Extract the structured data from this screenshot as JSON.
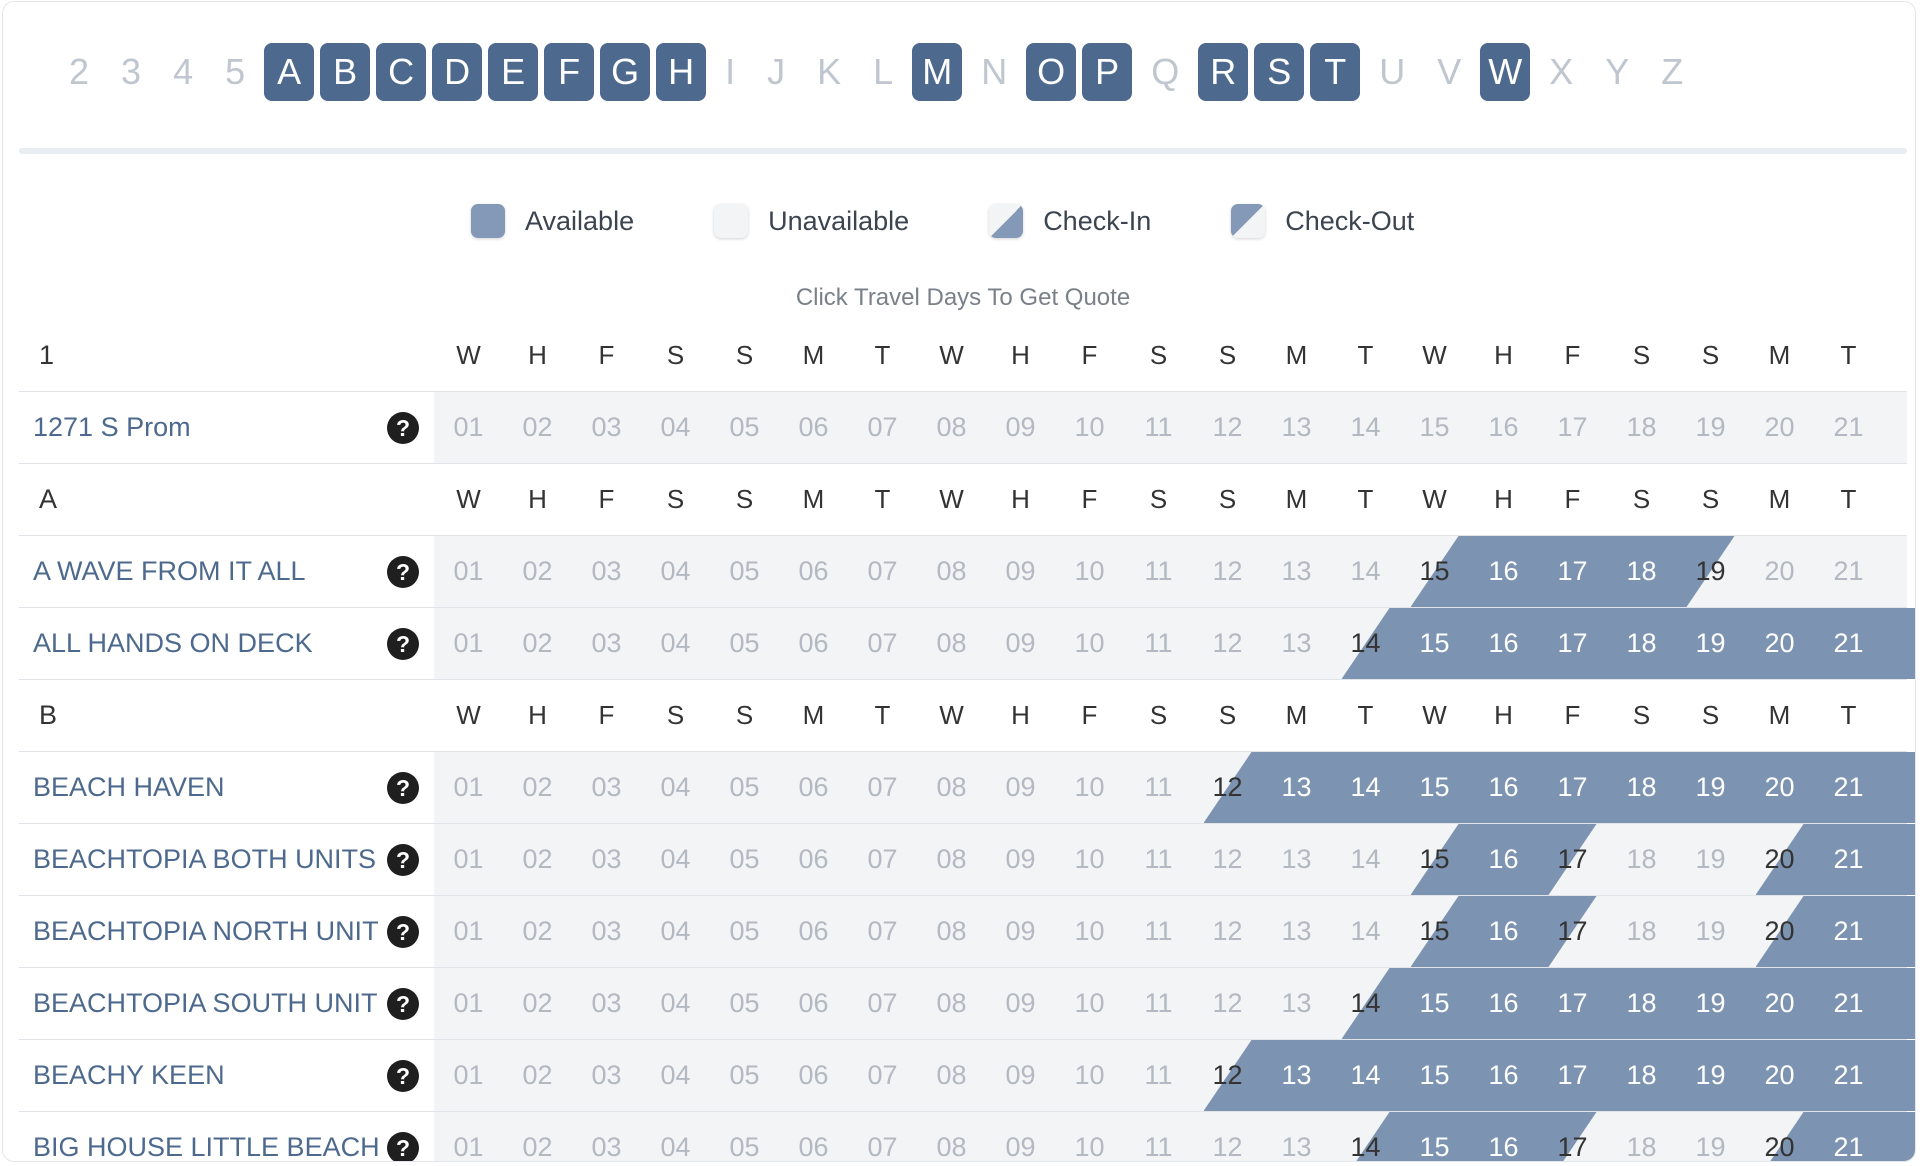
{
  "alphabet": [
    {
      "label": "2",
      "active": false
    },
    {
      "label": "3",
      "active": false
    },
    {
      "label": "4",
      "active": false
    },
    {
      "label": "5",
      "active": false
    },
    {
      "label": "A",
      "active": true
    },
    {
      "label": "B",
      "active": true
    },
    {
      "label": "C",
      "active": true
    },
    {
      "label": "D",
      "active": true
    },
    {
      "label": "E",
      "active": true
    },
    {
      "label": "F",
      "active": true
    },
    {
      "label": "G",
      "active": true
    },
    {
      "label": "H",
      "active": true
    },
    {
      "label": "I",
      "active": false
    },
    {
      "label": "J",
      "active": false
    },
    {
      "label": "K",
      "active": false
    },
    {
      "label": "L",
      "active": false
    },
    {
      "label": "M",
      "active": true
    },
    {
      "label": "N",
      "active": false
    },
    {
      "label": "O",
      "active": true
    },
    {
      "label": "P",
      "active": true
    },
    {
      "label": "Q",
      "active": false
    },
    {
      "label": "R",
      "active": true
    },
    {
      "label": "S",
      "active": true
    },
    {
      "label": "T",
      "active": true
    },
    {
      "label": "U",
      "active": false
    },
    {
      "label": "V",
      "active": false
    },
    {
      "label": "W",
      "active": true
    },
    {
      "label": "X",
      "active": false
    },
    {
      "label": "Y",
      "active": false
    },
    {
      "label": "Z",
      "active": false
    }
  ],
  "legend": {
    "available": "Available",
    "unavailable": "Unavailable",
    "check_in": "Check-In",
    "check_out": "Check-Out"
  },
  "hint": "Click Travel Days To Get Quote",
  "colors": {
    "accent": "#4d6a8e",
    "available": "#7c93b2",
    "unavailable": "#f3f4f6"
  },
  "weekdays": [
    "W",
    "H",
    "F",
    "S",
    "S",
    "M",
    "T",
    "W",
    "H",
    "F",
    "S",
    "S",
    "M",
    "T",
    "W",
    "H",
    "F",
    "S",
    "S",
    "M",
    "T"
  ],
  "dates": [
    "01",
    "02",
    "03",
    "04",
    "05",
    "06",
    "07",
    "08",
    "09",
    "10",
    "11",
    "12",
    "13",
    "14",
    "15",
    "16",
    "17",
    "18",
    "19",
    "20",
    "21"
  ],
  "groups": [
    {
      "label": "1",
      "units": [
        {
          "name": "1271 S Prom",
          "segments": []
        }
      ]
    },
    {
      "label": "A",
      "units": [
        {
          "name": "A WAVE FROM IT ALL",
          "segments": [
            [
              15,
              19
            ]
          ]
        },
        {
          "name": "ALL HANDS ON DECK",
          "segments": [
            [
              14,
              22
            ]
          ]
        }
      ]
    },
    {
      "label": "B",
      "units": [
        {
          "name": "BEACH HAVEN",
          "segments": [
            [
              12,
              22
            ]
          ]
        },
        {
          "name": "BEACHTOPIA BOTH UNITS",
          "segments": [
            [
              15,
              17
            ],
            [
              20,
              22
            ]
          ]
        },
        {
          "name": "BEACHTOPIA NORTH UNIT",
          "segments": [
            [
              15,
              17
            ],
            [
              20,
              22
            ]
          ]
        },
        {
          "name": "BEACHTOPIA SOUTH UNIT",
          "segments": [
            [
              14,
              22
            ]
          ]
        },
        {
          "name": "BEACHY KEEN",
          "segments": [
            [
              12,
              22
            ]
          ]
        },
        {
          "name": "BIG HOUSE LITTLE BEACH",
          "segments": [
            [
              14,
              17
            ],
            [
              20,
              22
            ]
          ]
        }
      ]
    }
  ]
}
